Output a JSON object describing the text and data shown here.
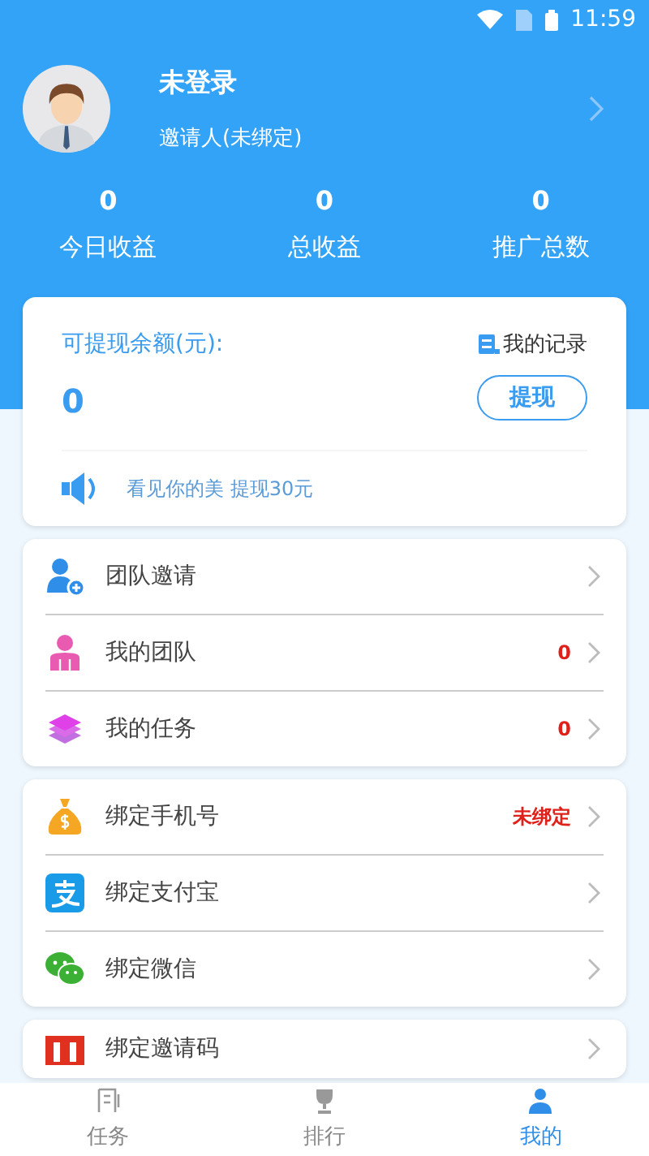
{
  "status_bar": {
    "time": "11:59"
  },
  "profile": {
    "name": "未登录",
    "inviter": "邀请人(未绑定)"
  },
  "stats": [
    {
      "value": "0",
      "label": "今日收益"
    },
    {
      "value": "0",
      "label": "总收益"
    },
    {
      "value": "0",
      "label": "推广总数"
    }
  ],
  "balance_card": {
    "label": "可提现余额(元):",
    "amount": "0",
    "records_link": "我的记录",
    "withdraw_button": "提现",
    "notice": "看见你的美 提现30元"
  },
  "menu_groups": [
    {
      "items": [
        {
          "kind": "invite",
          "label": "团队邀请"
        },
        {
          "kind": "team",
          "label": "我的团队",
          "badge": "0"
        },
        {
          "kind": "tasks",
          "label": "我的任务",
          "badge": "0"
        }
      ]
    },
    {
      "items": [
        {
          "kind": "phone",
          "label": "绑定手机号",
          "badge": "未绑定"
        },
        {
          "kind": "alipay",
          "label": "绑定支付宝"
        },
        {
          "kind": "wechat",
          "label": "绑定微信"
        }
      ]
    },
    {
      "items": [
        {
          "kind": "code",
          "label": "绑定邀请码"
        }
      ]
    }
  ],
  "tabs": [
    {
      "kind": "tasks",
      "label": "任务",
      "selected": false
    },
    {
      "kind": "rank",
      "label": "排行",
      "selected": false
    },
    {
      "kind": "mine",
      "label": "我的",
      "selected": true
    }
  ]
}
